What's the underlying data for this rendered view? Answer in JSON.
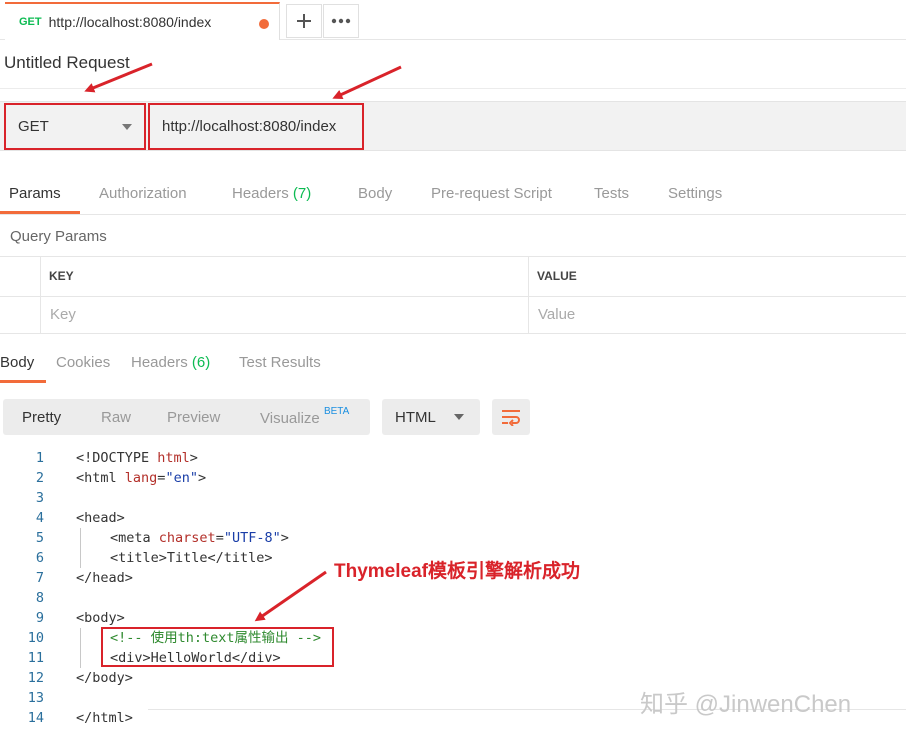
{
  "tab": {
    "method": "GET",
    "url": "http://localhost:8080/index",
    "add_icon": "plus-icon",
    "more_icon": "ellipsis-icon"
  },
  "request": {
    "title": "Untitled Request",
    "method": "GET",
    "url": "http://localhost:8080/index"
  },
  "request_tabs": {
    "params": "Params",
    "authorization": "Authorization",
    "headers": "Headers",
    "headers_count": "(7)",
    "body": "Body",
    "prerequest": "Pre-request Script",
    "tests": "Tests",
    "settings": "Settings"
  },
  "query_params": {
    "title": "Query Params",
    "key_header": "KEY",
    "value_header": "VALUE",
    "key_placeholder": "Key",
    "value_placeholder": "Value"
  },
  "response_tabs": {
    "body": "Body",
    "cookies": "Cookies",
    "headers": "Headers",
    "headers_count": "(6)",
    "test_results": "Test Results"
  },
  "view": {
    "pretty": "Pretty",
    "raw": "Raw",
    "preview": "Preview",
    "visualize": "Visualize",
    "beta": "BETA",
    "language": "HTML"
  },
  "code": {
    "line_numbers": [
      "1",
      "2",
      "3",
      "4",
      "5",
      "6",
      "7",
      "8",
      "9",
      "10",
      "11",
      "12",
      "13",
      "14"
    ],
    "l1": {
      "a": "<!DOCTYPE ",
      "b": "html",
      "c": ">"
    },
    "l2": {
      "a": "<html ",
      "b": "lang",
      "c": "=",
      "d": "\"en\"",
      "e": ">"
    },
    "l4": "<head>",
    "l5": {
      "a": "<meta ",
      "b": "charset",
      "c": "=",
      "d": "\"UTF-8\"",
      "e": ">"
    },
    "l6": "<title>Title</title>",
    "l7": "</head>",
    "l9": "<body>",
    "l10": "<!-- 使用th:text属性输出 -->",
    "l11": "<div>HelloWorld</div>",
    "l12": "</body>",
    "l14": "</html>"
  },
  "annotation": "Thymeleaf模板引擎解析成功",
  "watermark": "知乎 @JinwenChen",
  "colors": {
    "accent": "#f26b3a",
    "highlight": "#d9232a",
    "count": "#0cbb52"
  }
}
